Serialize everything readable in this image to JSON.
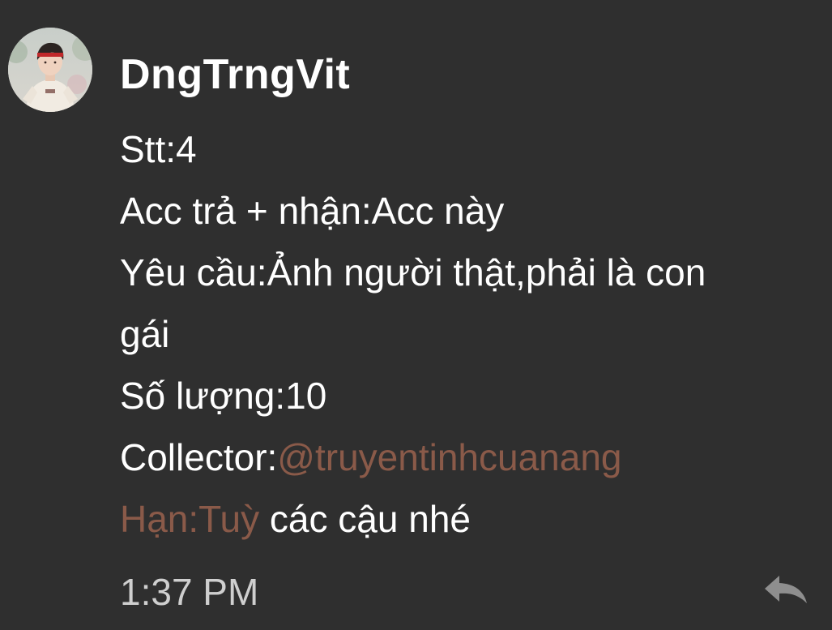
{
  "message": {
    "author": "DngTrngVit",
    "lines": {
      "stt": "Stt:4",
      "acc": "Acc trả + nhận:Acc này",
      "yeucau_1": "Yêu cầu:Ảnh người thật,phải là con",
      "yeucau_2": "gái",
      "soluong": "Số lượng:10",
      "collector_label": "Collector:",
      "collector_mention": "@truyentinhcuanang",
      "han_label": "Hạn:Tuỳ",
      "han_rest": " các cậu nhé"
    },
    "time": "1:37 PM",
    "reply_icon": "reply-arrow-icon"
  },
  "colors": {
    "background": "#2f2f2f",
    "text": "#ffffff",
    "mention": "#8a5a49",
    "timestamp": "#cfcfcf"
  }
}
